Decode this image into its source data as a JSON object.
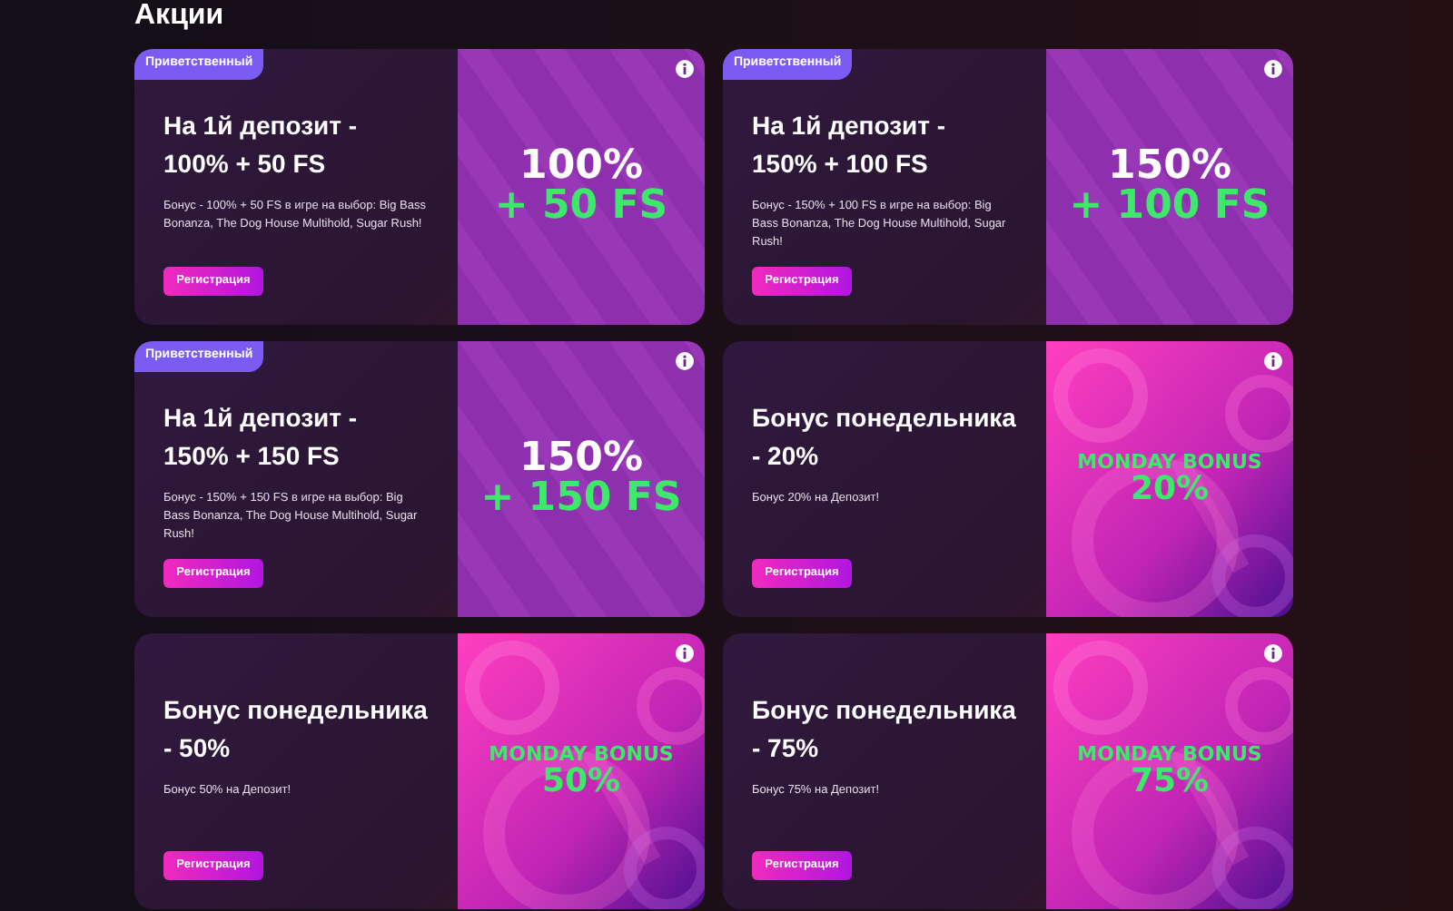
{
  "page_title": "Акции",
  "promotions": [
    {
      "badge": "Приветственный",
      "title": "На 1й депозит - 100% + 50 FS",
      "description": "Бонус - 100% + 50 FS в игре на выбор: Big Bass Bonanza, The Dog House Multihold, Sugar Rush!",
      "button": "Регистрация",
      "banner": {
        "kind": "welcome",
        "line_1": "100%",
        "line_2": "+ 50 FS"
      }
    },
    {
      "badge": "Приветственный",
      "title": "На 1й депозит - 150% + 100 FS",
      "description": "Бонус - 150% + 100 FS в игре на выбор: Big Bass Bonanza, The Dog House Multihold, Sugar Rush!",
      "button": "Регистрация",
      "banner": {
        "kind": "welcome",
        "line_1": "150%",
        "line_2": "+ 100 FS"
      }
    },
    {
      "badge": "Приветственный",
      "title": "На 1й депозит - 150% + 150 FS",
      "description": "Бонус - 150% + 150 FS в игре на выбор: Big Bass Bonanza, The Dog House Multihold, Sugar Rush!",
      "button": "Регистрация",
      "banner": {
        "kind": "welcome",
        "line_1": "150%",
        "line_2": "+ 150 FS"
      }
    },
    {
      "title": "Бонус понедельника - 20%",
      "description": "Бонус 20% на Депозит!",
      "button": "Регистрация",
      "banner": {
        "kind": "monday",
        "line_1": "MONDAY BONUS",
        "line_2": "20%"
      }
    },
    {
      "title": "Бонус понедельника - 50%",
      "description": "Бонус 50% на Депозит!",
      "button": "Регистрация",
      "banner": {
        "kind": "monday",
        "line_1": "MONDAY BONUS",
        "line_2": "50%"
      }
    },
    {
      "title": "Бонус понедельника - 75%",
      "description": "Бонус 75% на Депозит!",
      "button": "Регистрация",
      "banner": {
        "kind": "monday",
        "line_1": "MONDAY BONUS",
        "line_2": "75%"
      }
    }
  ]
}
